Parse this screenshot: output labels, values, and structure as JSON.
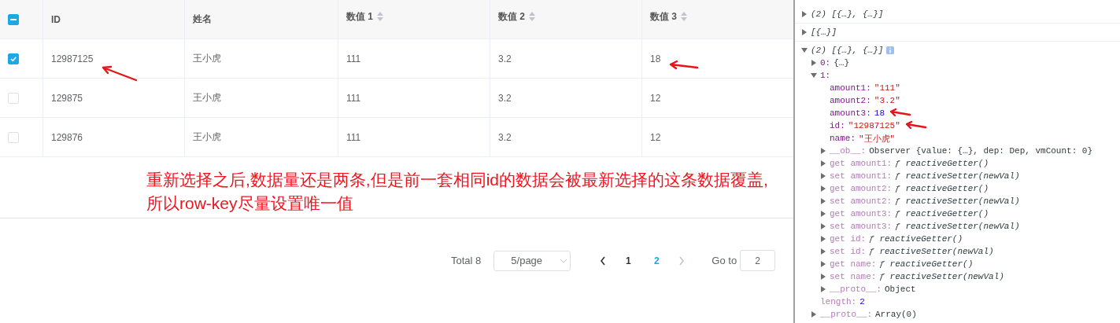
{
  "table": {
    "select_all": {
      "indeterminate": true
    },
    "columns": [
      {
        "label": "ID",
        "sortable": false
      },
      {
        "label": "姓名",
        "sortable": false
      },
      {
        "label": "数值 1",
        "sortable": true
      },
      {
        "label": "数值 2",
        "sortable": true
      },
      {
        "label": "数值 3",
        "sortable": true
      }
    ],
    "rows": [
      {
        "selected": true,
        "cells": [
          {
            "text": "12987125",
            "annotated": true
          },
          {
            "text": "王小虎"
          },
          {
            "text": "111"
          },
          {
            "text": "3.2"
          },
          {
            "text": "18",
            "annotated": true
          }
        ]
      },
      {
        "selected": false,
        "cells": [
          {
            "text": "129875"
          },
          {
            "text": "王小虎"
          },
          {
            "text": "111"
          },
          {
            "text": "3.2"
          },
          {
            "text": "12"
          }
        ]
      },
      {
        "selected": false,
        "cells": [
          {
            "text": "129876"
          },
          {
            "text": "王小虎"
          },
          {
            "text": "111"
          },
          {
            "text": "3.2"
          },
          {
            "text": "12"
          }
        ]
      }
    ]
  },
  "annotation": [
    "重新选择之后,数据量还是两条,但是前一套相同id的数据会被最新选择的这条数据覆盖,",
    "所以row-key尽量设置唯一值"
  ],
  "pagination": {
    "total": "Total 8",
    "page_size": "5/page",
    "pages": [
      {
        "label": "1",
        "selected": false
      },
      {
        "label": "2",
        "selected": true
      }
    ],
    "prev_disabled": false,
    "next_disabled": true,
    "goto_label": "Go to",
    "goto_value": "2"
  },
  "console": [
    {
      "kind": "summary",
      "value": "(2) [{…}, {…}]",
      "expanded": false
    },
    {
      "kind": "summary",
      "value": "[{…}]",
      "expanded": false
    },
    {
      "kind": "summary",
      "value": "(2) [{…}, {…}]",
      "expanded": true,
      "info": true,
      "children": [
        {
          "kind": "object",
          "key": "0:",
          "value": "{…}",
          "expanded": false
        },
        {
          "kind": "object",
          "key": "1:",
          "expanded": true,
          "children": [
            {
              "kind": "string",
              "key": "amount1:",
              "value": "\"111\""
            },
            {
              "kind": "string",
              "key": "amount2:",
              "value": "\"3.2\""
            },
            {
              "kind": "number",
              "key": "amount3:",
              "value": "18",
              "annotated": true
            },
            {
              "kind": "string",
              "key": "id:",
              "value": "\"12987125\"",
              "annotated": true
            },
            {
              "kind": "string",
              "key": "name:",
              "value": "\"王小虎\""
            },
            {
              "kind": "internal",
              "key": "__ob__:",
              "value": "Observer {value: {…}, dep: Dep, vmCount: 0}",
              "expanded": false
            },
            {
              "kind": "accessor",
              "key": "get amount1:",
              "value": "ƒ reactiveGetter()",
              "expanded": false
            },
            {
              "kind": "accessor",
              "key": "set amount1:",
              "value": "ƒ reactiveSetter(newVal)",
              "expanded": false
            },
            {
              "kind": "accessor",
              "key": "get amount2:",
              "value": "ƒ reactiveGetter()",
              "expanded": false
            },
            {
              "kind": "accessor",
              "key": "set amount2:",
              "value": "ƒ reactiveSetter(newVal)",
              "expanded": false
            },
            {
              "kind": "accessor",
              "key": "get amount3:",
              "value": "ƒ reactiveGetter()",
              "expanded": false
            },
            {
              "kind": "accessor",
              "key": "set amount3:",
              "value": "ƒ reactiveSetter(newVal)",
              "expanded": false
            },
            {
              "kind": "accessor",
              "key": "get id:",
              "value": "ƒ reactiveGetter()",
              "expanded": false
            },
            {
              "kind": "accessor",
              "key": "set id:",
              "value": "ƒ reactiveSetter(newVal)",
              "expanded": false
            },
            {
              "kind": "accessor",
              "key": "get name:",
              "value": "ƒ reactiveGetter()",
              "expanded": false
            },
            {
              "kind": "accessor",
              "key": "set name:",
              "value": "ƒ reactiveSetter(newVal)",
              "expanded": false
            },
            {
              "kind": "internal",
              "key": "__proto__:",
              "value": "Object",
              "expanded": false
            }
          ]
        },
        {
          "kind": "meta",
          "key": "length:",
          "value": "2"
        },
        {
          "kind": "internal",
          "key": "__proto__:",
          "value": "Array(0)",
          "expanded": false
        }
      ]
    }
  ]
}
